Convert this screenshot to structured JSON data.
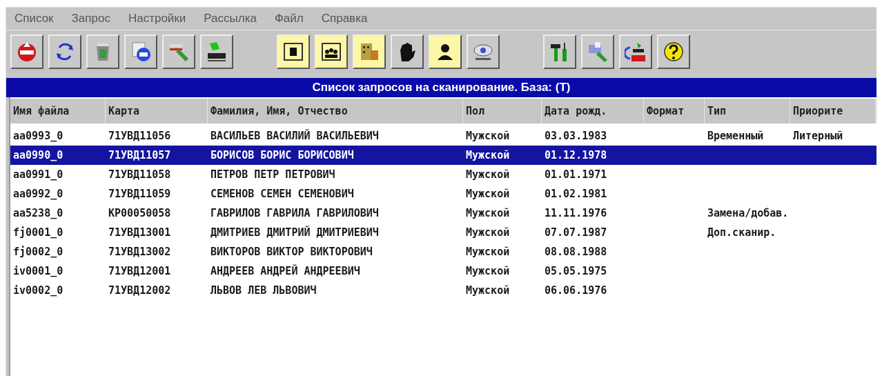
{
  "menu": [
    "Список",
    "Запрос",
    "Настройки",
    "Рассылка",
    "Файл",
    "Справка"
  ],
  "toolbar": [
    [
      {
        "kind": "exit",
        "active": false
      },
      {
        "kind": "refresh",
        "active": false
      },
      {
        "kind": "bin",
        "active": false
      },
      {
        "kind": "text",
        "active": false
      },
      {
        "kind": "edit",
        "active": false
      },
      {
        "kind": "scanner",
        "active": false
      }
    ],
    [
      {
        "kind": "single",
        "active": true
      },
      {
        "kind": "group",
        "active": true
      },
      {
        "kind": "building",
        "active": true
      },
      {
        "kind": "hand",
        "active": false
      },
      {
        "kind": "person",
        "active": true
      },
      {
        "kind": "eye",
        "active": false
      }
    ],
    [
      {
        "kind": "tools",
        "active": false
      },
      {
        "kind": "card",
        "active": false
      },
      {
        "kind": "tiff",
        "active": false
      },
      {
        "kind": "help",
        "active": false
      }
    ]
  ],
  "list_title": "Список запросов на сканирование. База: (T)",
  "table": {
    "columns": [
      "Имя файла",
      "Карта",
      "Фамилия, Имя, Отчество",
      "Пол",
      "Дата рожд.",
      "Формат",
      "Тип",
      "Приорите"
    ],
    "rows": [
      {
        "selected": false,
        "cells": [
          "aa0993_0",
          "71УВД11056",
          "ВАСИЛЬЕВ ВАСИЛИЙ ВАСИЛЬЕВИЧ",
          "Мужской",
          "03.03.1983",
          "",
          "Временный",
          "Литерный"
        ]
      },
      {
        "selected": true,
        "cells": [
          "aa0990_0",
          "71УВД11057",
          "БОРИСОВ БОРИС БОРИСОВИЧ",
          "Мужской",
          "01.12.1978",
          "",
          "",
          ""
        ]
      },
      {
        "selected": false,
        "cells": [
          "aa0991_0",
          "71УВД11058",
          "ПЕТРОВ ПЕТР ПЕТРОВИЧ",
          "Мужской",
          "01.01.1971",
          "",
          "",
          ""
        ]
      },
      {
        "selected": false,
        "cells": [
          "aa0992_0",
          "71УВД11059",
          "СЕМЕНОВ СЕМЕН СЕМЕНОВИЧ",
          "Мужской",
          "01.02.1981",
          "",
          "",
          ""
        ]
      },
      {
        "selected": false,
        "cells": [
          "aa5238_0",
          "КР00050058",
          "ГАВРИЛОВ ГАВРИЛА ГАВРИЛОВИЧ",
          "Мужской",
          "11.11.1976",
          "",
          "Замена/добав.",
          ""
        ]
      },
      {
        "selected": false,
        "cells": [
          "fj0001_0",
          "71УВД13001",
          "ДМИТРИЕВ ДМИТРИЙ ДМИТРИЕВИЧ",
          "Мужской",
          "07.07.1987",
          "",
          "Доп.сканир.",
          ""
        ]
      },
      {
        "selected": false,
        "cells": [
          "fj0002_0",
          "71УВД13002",
          "ВИКТОРОВ ВИКТОР ВИКТОРОВИЧ",
          "Мужской",
          "08.08.1988",
          "",
          "",
          ""
        ]
      },
      {
        "selected": false,
        "cells": [
          "iv0001_0",
          "71УВД12001",
          "АНДРЕЕВ АНДРЕЙ АНДРЕЕВИЧ",
          "Мужской",
          "05.05.1975",
          "",
          "",
          ""
        ]
      },
      {
        "selected": false,
        "cells": [
          "iv0002_0",
          "71УВД12002",
          "ЛЬВОВ ЛЕВ ЛЬВОВИЧ",
          "Мужской",
          "06.06.1976",
          "",
          "",
          ""
        ]
      }
    ]
  }
}
